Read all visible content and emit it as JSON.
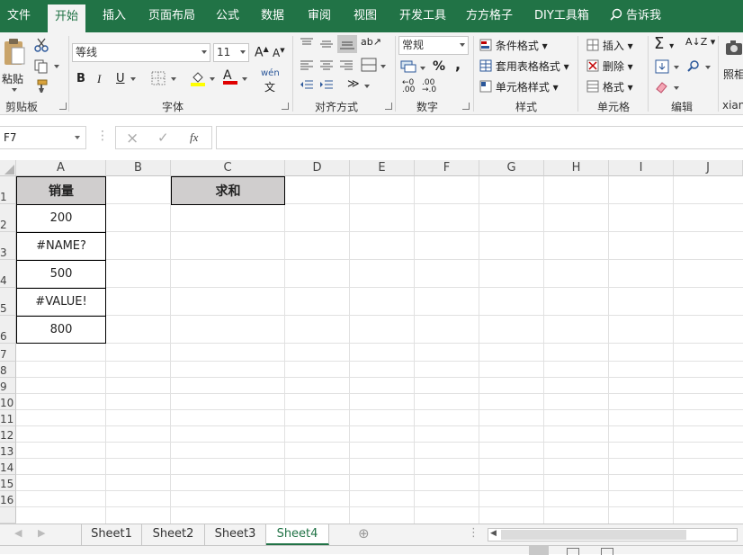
{
  "menu": {
    "tabs": [
      "文件",
      "开始",
      "插入",
      "页面布局",
      "公式",
      "数据",
      "审阅",
      "视图",
      "开发工具",
      "方方格子",
      "DIY工具箱"
    ],
    "active": "开始",
    "search": "告诉我"
  },
  "ribbon": {
    "clipboard": {
      "paste": "粘贴",
      "label": "剪贴板"
    },
    "font": {
      "name": "等线",
      "size": "11",
      "bold": "B",
      "italic": "I",
      "underline": "U",
      "phonetic": "wén",
      "label": "字体"
    },
    "alignment": {
      "label": "对齐方式"
    },
    "number": {
      "format": "常规",
      "percent": "%",
      "comma": ",",
      "label": "数字"
    },
    "styles": {
      "conditional": "条件格式",
      "table": "套用表格格式",
      "cell": "单元格样式",
      "label": "样式"
    },
    "cells": {
      "insert": "插入",
      "delete": "删除",
      "format": "格式",
      "label": "单元格"
    },
    "editing": {
      "label": "编辑"
    },
    "extra": {
      "photo": "照相",
      "label": "xian"
    }
  },
  "formula_bar": {
    "name_box": "F7",
    "fx": "fx",
    "cancel": "×",
    "enter": "✓",
    "value": ""
  },
  "columns": [
    "A",
    "B",
    "C",
    "D",
    "E",
    "F",
    "G",
    "H",
    "I",
    "J"
  ],
  "rows": [
    "1",
    "2",
    "3",
    "4",
    "5",
    "6",
    "7",
    "8",
    "9",
    "10",
    "11",
    "12",
    "13",
    "14",
    "15",
    "16"
  ],
  "cells": {
    "A1": "销量",
    "A2": "200",
    "A3": "#NAME?",
    "A4": "500",
    "A5": "#VALUE!",
    "A6": "800",
    "C1": "求和"
  },
  "sheets": [
    "Sheet1",
    "Sheet2",
    "Sheet3",
    "Sheet4"
  ],
  "active_sheet": "Sheet4",
  "colors": {
    "excel_green": "#217346",
    "header_fill": "#d0cece"
  }
}
